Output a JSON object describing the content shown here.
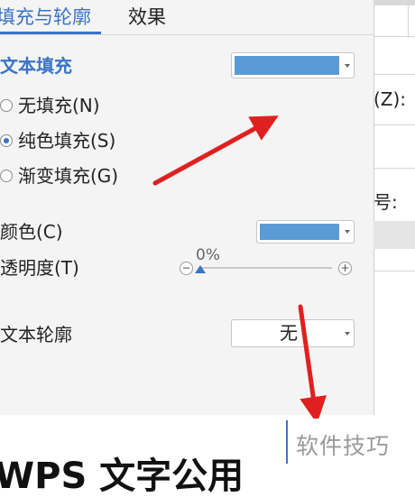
{
  "tabs": [
    {
      "label": "填充与轮廓"
    },
    {
      "label": "效果"
    }
  ],
  "text_fill": {
    "title": "文本填充",
    "color": "#5b9bd5",
    "options": [
      {
        "label": "无填充(N)",
        "checked": false
      },
      {
        "label": "纯色填充(S)",
        "checked": true
      },
      {
        "label": "渐变填充(G)",
        "checked": false
      }
    ]
  },
  "color_field": {
    "label": "颜色(C)",
    "value_color": "#5b9bd5"
  },
  "transparency": {
    "label": "透明度(T)",
    "value_text": "0%",
    "minus": "−",
    "plus": "+"
  },
  "text_outline": {
    "label": "文本轮廓",
    "value": "无"
  },
  "right_panel": {
    "label_z": "(Z):",
    "label_hao": "号:"
  },
  "watermark": {
    "text": "软件技巧"
  },
  "bottom": {
    "text": "WPS 文字公用"
  },
  "colors": {
    "accent": "#3a74c5",
    "annotation_arrow": "#e02020"
  }
}
